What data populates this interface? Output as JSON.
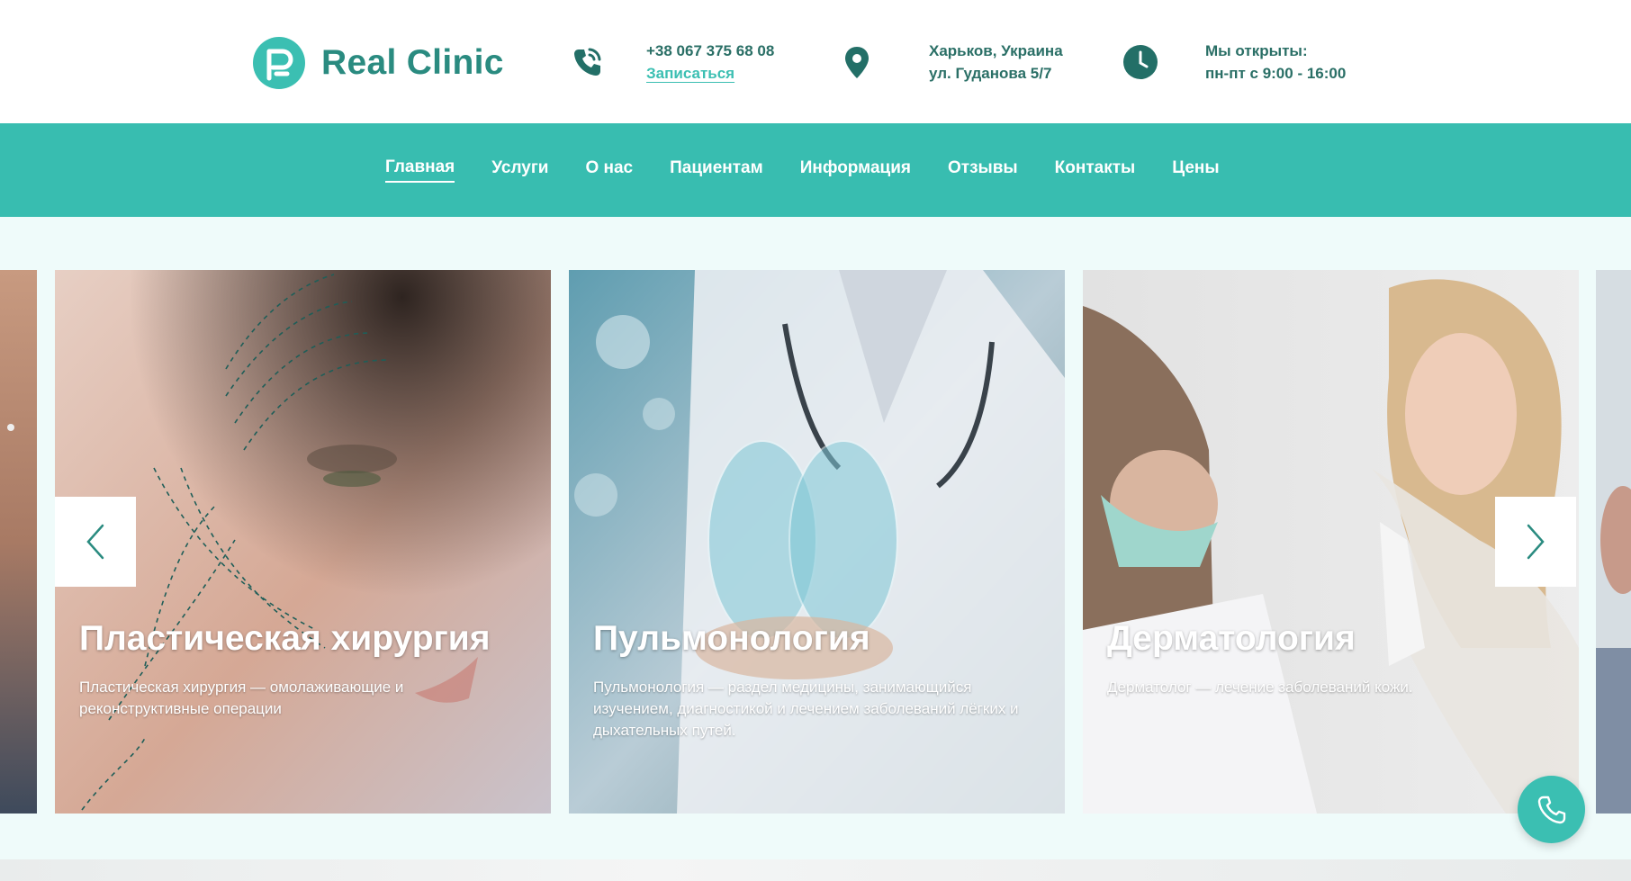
{
  "brand": {
    "name": "Real Clinic"
  },
  "header": {
    "phone": "+38 067 375 68 08",
    "signup_link": "Записаться",
    "city": "Харьков, Украина",
    "street": "ул. Гуданова 5/7",
    "hours_label": "Мы открыты:",
    "hours_value": "пн-пт с 9:00 - 16:00"
  },
  "nav": {
    "items": [
      {
        "label": "Главная",
        "active": true
      },
      {
        "label": "Услуги"
      },
      {
        "label": "О нас"
      },
      {
        "label": "Пациентам"
      },
      {
        "label": "Информация"
      },
      {
        "label": "Отзывы"
      },
      {
        "label": "Контакты"
      },
      {
        "label": "Цены"
      }
    ]
  },
  "slides": [
    {
      "title": "Пластическая хирургия",
      "description": "Пластическая хирургия — омолаживающие и реконструктивные операции"
    },
    {
      "title": "Пульмонология",
      "description": "Пульмонология — раздел медицины, занимающийся изучением, диагностикой и лечением заболеваний лёгких и дыхательных путей."
    },
    {
      "title": "Дерматология",
      "description": "Дерматолог — лечение заболеваний кожи."
    }
  ],
  "icons": {
    "phone": "phone-icon",
    "location": "map-pin-icon",
    "hours": "clock-icon",
    "prev": "chevron-left-icon",
    "next": "chevron-right-icon",
    "call": "phone-icon"
  },
  "colors": {
    "accent": "#38bdb0",
    "text_dark": "#2a6f66",
    "slider_bg": "#effbfa"
  }
}
